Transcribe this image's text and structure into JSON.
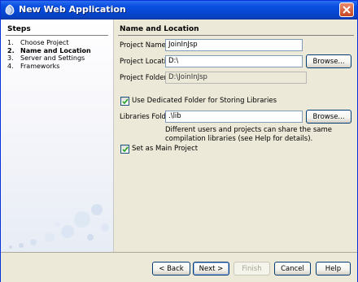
{
  "window": {
    "title": "New Web Application"
  },
  "steps": {
    "title": "Steps",
    "items": [
      {
        "num": "1.",
        "label": "Choose Project"
      },
      {
        "num": "2.",
        "label": "Name and Location"
      },
      {
        "num": "3.",
        "label": "Server and Settings"
      },
      {
        "num": "4.",
        "label": "Frameworks"
      }
    ]
  },
  "form": {
    "section_title": "Name and Location",
    "project_name_label": "Project Name:",
    "project_name_value": "JoinInJsp",
    "project_location_label": "Project Location:",
    "project_location_value": "D:\\",
    "browse_label": "Browse...",
    "project_folder_label": "Project Folder:",
    "project_folder_value": "D:\\JoinInJsp",
    "use_dedicated_label": "Use Dedicated Folder for Storing Libraries",
    "use_dedicated_checked": true,
    "libraries_folder_label": "Libraries Folder:",
    "libraries_folder_value": ".\\lib",
    "libraries_browse_label": "Browse...",
    "note_line1": "Different users and projects can share the same",
    "note_line2": "compilation libraries (see Help for details).",
    "main_project_label": "Set as Main Project",
    "main_project_checked": true
  },
  "footer": {
    "back_label": "< Back",
    "next_label": "Next >",
    "finish_label": "Finish",
    "cancel_label": "Cancel",
    "help_label": "Help"
  }
}
